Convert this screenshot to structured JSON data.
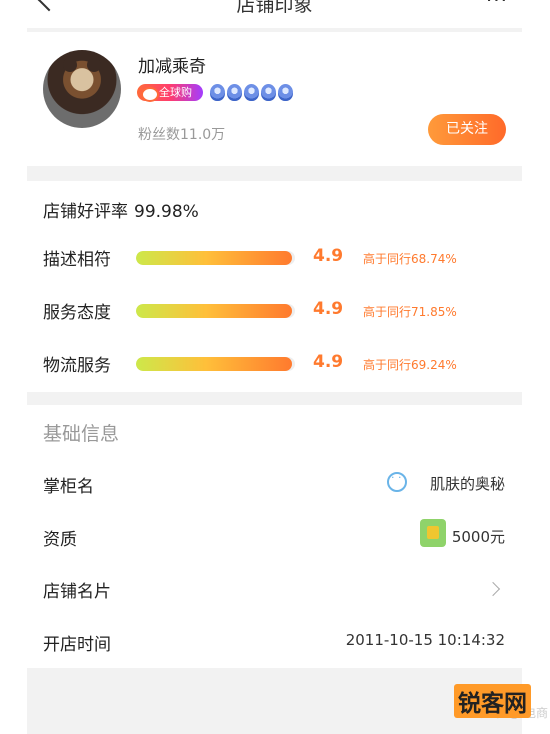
{
  "nav": {
    "title": "店铺印象",
    "more_label": "···"
  },
  "profile": {
    "shop_name": "加减乘奇",
    "global_badge": "全球购",
    "crown_count": 5,
    "fans": "粉丝数11.0万",
    "follow_label": "已关注"
  },
  "ratings": {
    "praise_label": "店铺好评率",
    "praise_value": "99.98%",
    "items": [
      {
        "label": "描述相符",
        "score": "4.9",
        "compare": "高于同行68.74%",
        "fill": 0.98
      },
      {
        "label": "服务态度",
        "score": "4.9",
        "compare": "高于同行71.85%",
        "fill": 0.98
      },
      {
        "label": "物流服务",
        "score": "4.9",
        "compare": "高于同行69.24%",
        "fill": 0.98
      }
    ]
  },
  "basic": {
    "section_title": "基础信息",
    "owner_label": "掌柜名",
    "owner_value": "肌肤的奥秘",
    "license_label": "资质",
    "license_value": "5000元",
    "card_label": "店铺名片",
    "opened_label": "开店时间",
    "opened_value": "2011-10-15 10:14:32"
  },
  "watermark": {
    "main": "锐客网",
    "faint": "头条 @ 电商"
  },
  "colors": {
    "accent": "#ff7a2e",
    "follow_start": "#ff9a3a",
    "follow_end": "#ff6a2a",
    "background": "#f2f2f2"
  }
}
